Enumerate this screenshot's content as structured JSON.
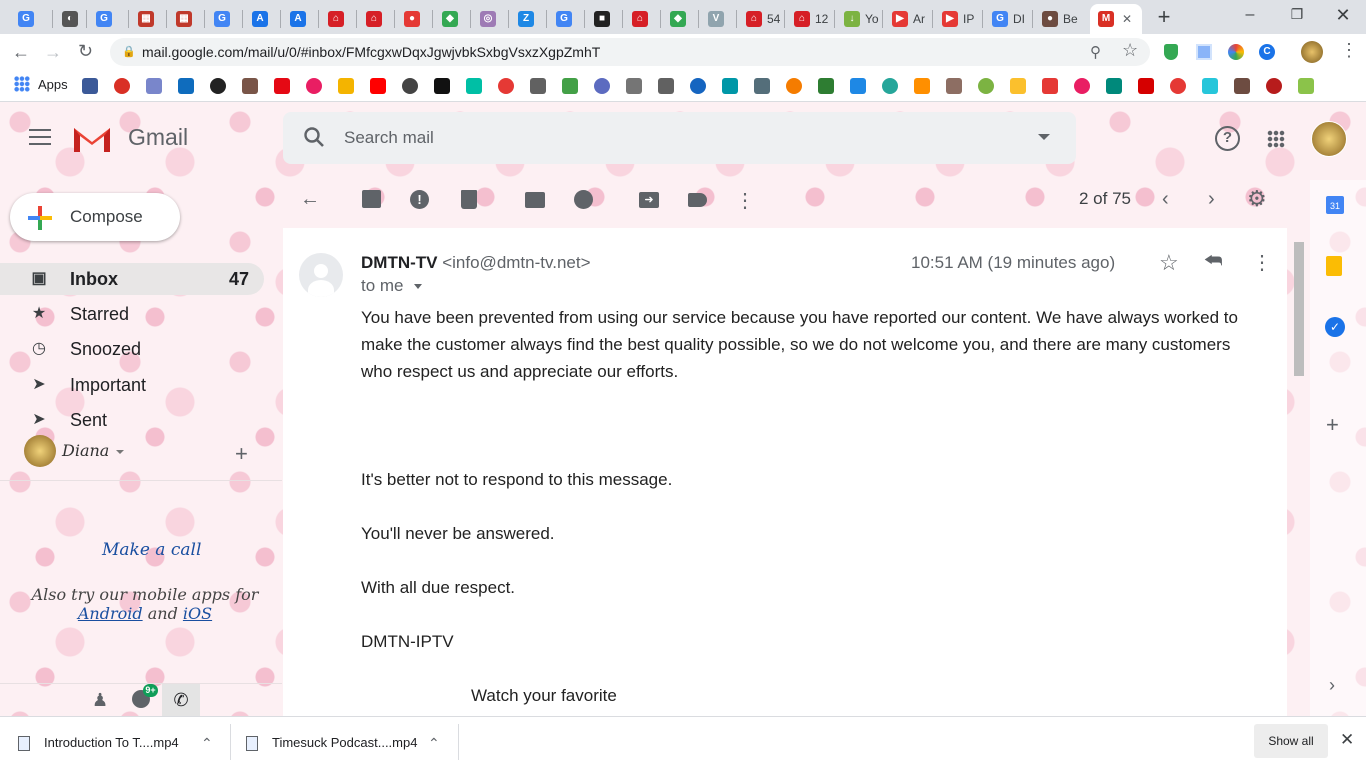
{
  "browser": {
    "tabs": [
      {
        "fav": "G",
        "color": "#4285f4",
        "label": ""
      },
      {
        "fav": "◐",
        "color": "#555555",
        "label": ""
      },
      {
        "fav": "G",
        "color": "#4285f4",
        "label": ""
      },
      {
        "fav": "▦",
        "color": "#c0392b",
        "label": ""
      },
      {
        "fav": "▦",
        "color": "#c0392b",
        "label": ""
      },
      {
        "fav": "G",
        "color": "#4285f4",
        "label": ""
      },
      {
        "fav": "A",
        "color": "#1a73e8",
        "label": ""
      },
      {
        "fav": "A",
        "color": "#1a73e8",
        "label": ""
      },
      {
        "fav": "⌂",
        "color": "#d61f26",
        "label": ""
      },
      {
        "fav": "⌂",
        "color": "#d61f26",
        "label": ""
      },
      {
        "fav": "●",
        "color": "#e53935",
        "label": ""
      },
      {
        "fav": "◆",
        "color": "#34a853",
        "label": ""
      },
      {
        "fav": "◎",
        "color": "#9e7bb5",
        "label": ""
      },
      {
        "fav": "Z",
        "color": "#1e88e5",
        "label": ""
      },
      {
        "fav": "G",
        "color": "#4285f4",
        "label": ""
      },
      {
        "fav": "■",
        "color": "#222222",
        "label": ""
      },
      {
        "fav": "⌂",
        "color": "#d61f26",
        "label": ""
      },
      {
        "fav": "◆",
        "color": "#34a853",
        "label": ""
      },
      {
        "fav": "V",
        "color": "#90a4ae",
        "label": ""
      },
      {
        "fav": "⌂",
        "color": "#d61f26",
        "label": "54"
      },
      {
        "fav": "⌂",
        "color": "#d61f26",
        "label": "12"
      },
      {
        "fav": "↓",
        "color": "#7cb342",
        "label": "Yo"
      },
      {
        "fav": "▶",
        "color": "#e53935",
        "label": "Ar"
      },
      {
        "fav": "▶",
        "color": "#e53935",
        "label": "IP"
      },
      {
        "fav": "G",
        "color": "#4285f4",
        "label": "DI"
      },
      {
        "fav": "●",
        "color": "#6d4c41",
        "label": "Be"
      },
      {
        "fav": "M",
        "color": "#d93025",
        "label": ""
      }
    ],
    "url": "mail.google.com/mail/u/0/#inbox/FMfcgxwDqxJgwjvbkSxbgVsxzXgpZmhT",
    "apps_label": "Apps",
    "bookmark_colors": [
      "#3b5998",
      "#d93025",
      "#7986cb",
      "#0f6cbd",
      "#222222",
      "#795548",
      "#e50914",
      "#e91e63",
      "#f4b400",
      "#ff0000",
      "#444444",
      "#111111",
      "#00bfa5",
      "#e53935",
      "#616161",
      "#43a047",
      "#5c6bc0",
      "#757575",
      "#616161",
      "#1565c0",
      "#0097a7",
      "#546e7a",
      "#f57c00",
      "#2e7d32",
      "#1e88e5",
      "#26a69a",
      "#ff8f00",
      "#8d6e63",
      "#7cb342",
      "#fbc02d",
      "#e53935",
      "#e91e63",
      "#00897b",
      "#d50000",
      "#e53935",
      "#26c6da",
      "#6d4c41",
      "#b71c1c",
      "#8bc34a"
    ]
  },
  "gmail": {
    "logo_text": "Gmail",
    "search_placeholder": "Search mail",
    "compose_label": "Compose",
    "nav": [
      {
        "label": "Inbox",
        "count": "47",
        "icon": "inbox-icon"
      },
      {
        "label": "Starred",
        "count": "",
        "icon": "star-icon"
      },
      {
        "label": "Snoozed",
        "count": "",
        "icon": "clock-icon"
      },
      {
        "label": "Important",
        "count": "",
        "icon": "important-icon"
      },
      {
        "label": "Sent",
        "count": "",
        "icon": "send-icon"
      }
    ],
    "hangouts_user": "Diana",
    "make_call": "Make a call",
    "mobile_apps_text": "Also try our mobile apps for",
    "android": "Android",
    "and": "and",
    "ios": "iOS",
    "pagination": "2 of 75",
    "hangouts_badge": "9+"
  },
  "email": {
    "sender_name": "DMTN-TV",
    "sender_email": "<info@dmtn-tv.net>",
    "to": "to me",
    "time": "10:51 AM (19 minutes ago)",
    "paragraphs": [
      "You have been prevented from using our service because you have reported our content. We have always worked to make the customer always find the best quality possible, so we do not welcome you, and there are many customers who respect us and appreciate our efforts.",
      "It's better not to respond to this message.",
      "You'll never be answered.",
      "With all due respect.",
      "DMTN-IPTV"
    ],
    "footer_line": "Watch your favorite"
  },
  "downloads": {
    "items": [
      "Introduction To T....mp4",
      "Timesuck Podcast....mp4"
    ],
    "show_all": "Show all"
  }
}
